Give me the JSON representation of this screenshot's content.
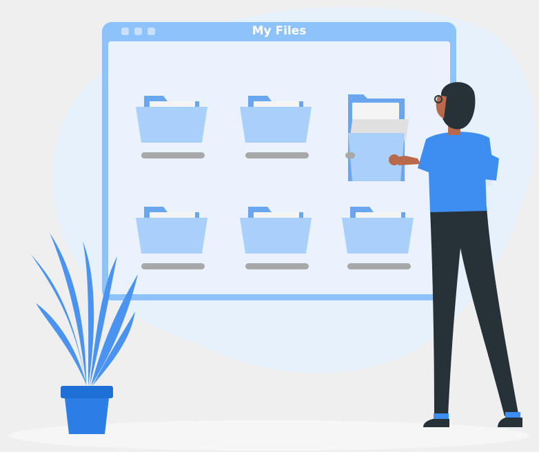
{
  "window": {
    "title": "My Files",
    "titlebar_color": "#8ec2fb",
    "content_color": "#eaf3fd"
  },
  "folders": [
    {
      "row": 1,
      "col": 1,
      "state": "closed"
    },
    {
      "row": 1,
      "col": 2,
      "state": "closed"
    },
    {
      "row": 1,
      "col": 3,
      "state": "open"
    },
    {
      "row": 2,
      "col": 1,
      "state": "closed"
    },
    {
      "row": 2,
      "col": 2,
      "state": "closed"
    },
    {
      "row": 2,
      "col": 3,
      "state": "closed"
    }
  ],
  "colors": {
    "background": "#efefef",
    "blob": "#e7f1fc",
    "folder_back": "#6aa6ee",
    "folder_front": "#a9d0fb",
    "paper": "#f4f4f4",
    "shirt": "#3d8ef0",
    "pants": "#263238",
    "plant": "#4a93f0",
    "pot": "#1f70d6"
  }
}
